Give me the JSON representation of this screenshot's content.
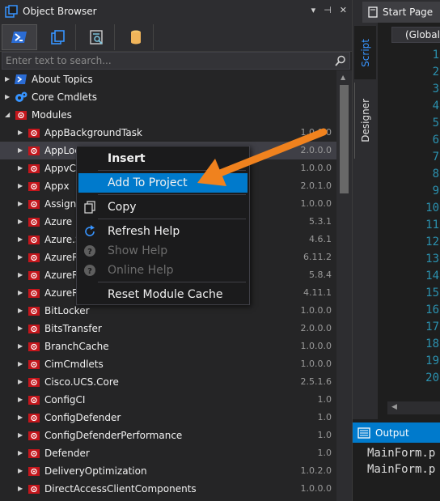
{
  "object_browser": {
    "title": "Object Browser",
    "title_buttons": [
      "▾",
      "⊣",
      "✕"
    ],
    "toolbar": [
      {
        "name": "powershell-icon",
        "color": "#2b6cd4"
      },
      {
        "name": "copy-windows-icon",
        "color": "#3794ff"
      },
      {
        "name": "search-document-icon",
        "color": "#7ec8e3"
      },
      {
        "name": "database-icon",
        "color": "#f0b45a"
      }
    ],
    "search_placeholder": "Enter text to search...",
    "tree": [
      {
        "label": "About Topics",
        "level": 0,
        "arrow": "collapsed",
        "icon": "about-topics-icon",
        "version": ""
      },
      {
        "label": "Core Cmdlets",
        "level": 0,
        "arrow": "collapsed",
        "icon": "core-cmdlets-icon",
        "version": ""
      },
      {
        "label": "Modules",
        "level": 0,
        "arrow": "expanded",
        "icon": "module-icon",
        "version": ""
      },
      {
        "label": "AppBackgroundTask",
        "level": 1,
        "arrow": "collapsed",
        "icon": "module-icon",
        "version": "1.0.0.0"
      },
      {
        "label": "AppLocker",
        "level": 1,
        "arrow": "collapsed",
        "icon": "module-icon",
        "version": "2.0.0.0",
        "selected": true
      },
      {
        "label": "AppvClient",
        "level": 1,
        "arrow": "collapsed",
        "icon": "module-icon",
        "version": "1.0.0.0"
      },
      {
        "label": "Appx",
        "level": 1,
        "arrow": "collapsed",
        "icon": "module-icon",
        "version": "2.0.1.0"
      },
      {
        "label": "AssignedAccess",
        "level": 1,
        "arrow": "collapsed",
        "icon": "module-icon",
        "version": "1.0.0.0"
      },
      {
        "label": "Azure",
        "level": 1,
        "arrow": "collapsed",
        "icon": "module-icon",
        "version": "5.3.1"
      },
      {
        "label": "Azure.Storage",
        "level": 1,
        "arrow": "collapsed",
        "icon": "module-icon",
        "version": "4.6.1"
      },
      {
        "label": "AzureRM",
        "level": 1,
        "arrow": "collapsed",
        "icon": "module-icon",
        "version": "6.11.2"
      },
      {
        "label": "AzureRM",
        "level": 1,
        "arrow": "collapsed",
        "icon": "module-icon",
        "version": "5.8.4"
      },
      {
        "label": "AzureRM",
        "level": 1,
        "arrow": "collapsed",
        "icon": "module-icon",
        "version": "4.11.1"
      },
      {
        "label": "BitLocker",
        "level": 1,
        "arrow": "collapsed",
        "icon": "module-icon",
        "version": "1.0.0.0"
      },
      {
        "label": "BitsTransfer",
        "level": 1,
        "arrow": "collapsed",
        "icon": "module-icon",
        "version": "2.0.0.0"
      },
      {
        "label": "BranchCache",
        "level": 1,
        "arrow": "collapsed",
        "icon": "module-icon",
        "version": "1.0.0.0"
      },
      {
        "label": "CimCmdlets",
        "level": 1,
        "arrow": "collapsed",
        "icon": "module-icon",
        "version": "1.0.0.0"
      },
      {
        "label": "Cisco.UCS.Core",
        "level": 1,
        "arrow": "collapsed",
        "icon": "module-icon",
        "version": "2.5.1.6"
      },
      {
        "label": "ConfigCI",
        "level": 1,
        "arrow": "collapsed",
        "icon": "module-icon",
        "version": "1.0"
      },
      {
        "label": "ConfigDefender",
        "level": 1,
        "arrow": "collapsed",
        "icon": "module-icon",
        "version": "1.0"
      },
      {
        "label": "ConfigDefenderPerformance",
        "level": 1,
        "arrow": "collapsed",
        "icon": "module-icon",
        "version": "1.0"
      },
      {
        "label": "Defender",
        "level": 1,
        "arrow": "collapsed",
        "icon": "module-icon",
        "version": "1.0"
      },
      {
        "label": "DeliveryOptimization",
        "level": 1,
        "arrow": "collapsed",
        "icon": "module-icon",
        "version": "1.0.2.0"
      },
      {
        "label": "DirectAccessClientComponents",
        "level": 1,
        "arrow": "collapsed",
        "icon": "module-icon",
        "version": "1.0.0.0"
      }
    ]
  },
  "context_menu": {
    "items": [
      {
        "label": "Insert",
        "bold": true,
        "icon": "",
        "disabled": false,
        "highlighted": false
      },
      {
        "label": "Add To Project",
        "bold": false,
        "icon": "",
        "disabled": false,
        "highlighted": true
      },
      {
        "label": "Copy",
        "bold": false,
        "icon": "copy-icon",
        "disabled": false,
        "highlighted": false
      },
      {
        "label": "Refresh Help",
        "bold": false,
        "icon": "refresh-icon",
        "disabled": false,
        "highlighted": false
      },
      {
        "label": "Show Help",
        "bold": false,
        "icon": "help-icon",
        "disabled": true,
        "highlighted": false
      },
      {
        "label": "Online Help",
        "bold": false,
        "icon": "help-icon",
        "disabled": true,
        "highlighted": false
      },
      {
        "label": "Reset Module Cache",
        "bold": false,
        "icon": "",
        "disabled": false,
        "highlighted": false
      }
    ]
  },
  "editor": {
    "tab_label": "Start Page",
    "side_tabs": [
      "Script",
      "Designer"
    ],
    "combo_value": "(Global S",
    "line_numbers": [
      "1",
      "2",
      "3",
      "4",
      "5",
      "6",
      "7",
      "8",
      "9",
      "10",
      "11",
      "12",
      "13",
      "14",
      "15",
      "16",
      "17",
      "18",
      "19",
      "20"
    ],
    "output_title": "Output",
    "output_lines": [
      "MainForm.p",
      "MainForm.p"
    ]
  },
  "colors": {
    "accent": "#007acc",
    "module_icon": "#c4161c",
    "callout_arrow": "#f0821e",
    "line_number": "#2b91af"
  }
}
